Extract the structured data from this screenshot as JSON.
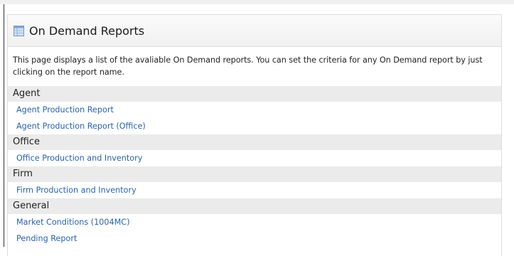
{
  "panel": {
    "title": "On Demand Reports",
    "description": "This page displays a list of the avaliable On Demand reports. You can set the criteria for any On Demand report by just clicking on the report name."
  },
  "categories": [
    {
      "name": "Agent",
      "reports": [
        "Agent Production Report",
        "Agent Production Report (Office)"
      ]
    },
    {
      "name": "Office",
      "reports": [
        "Office Production and Inventory"
      ]
    },
    {
      "name": "Firm",
      "reports": [
        "Firm Production and Inventory"
      ]
    },
    {
      "name": "General",
      "reports": [
        "Market Conditions (1004MC)",
        "Pending Report"
      ]
    }
  ],
  "colors": {
    "link": "#2a62a8",
    "category_bg": "#ebebeb",
    "header_bg": "#f3f3f3"
  },
  "icons": {
    "header": "report-icon"
  }
}
